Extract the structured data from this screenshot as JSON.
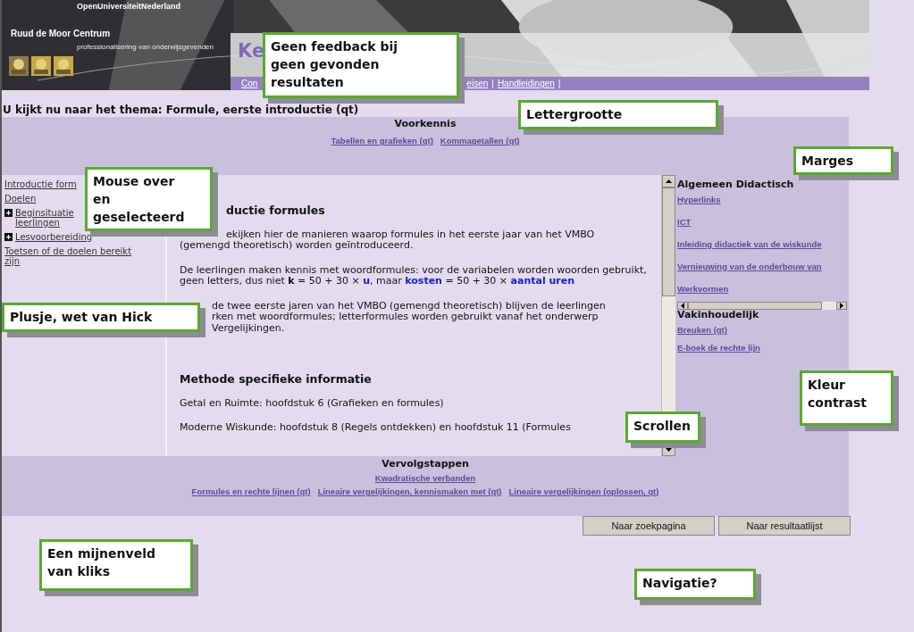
{
  "banner": {
    "institution": "OpenUniversiteitNederland",
    "centre": "Ruud de Moor Centrum",
    "tagline": "professionalisering van onderwijsgevenden",
    "title": "Ke",
    "nav_start": "Con",
    "nav": [
      {
        "kind": "link",
        "label": "eisen"
      },
      {
        "kind": "sep",
        "label": "|"
      },
      {
        "kind": "link",
        "label": "Handleidingen"
      },
      {
        "kind": "sep",
        "label": "|"
      }
    ]
  },
  "theme_line": "U kijkt nu naar het thema: Formule, eerste introductie (qt)",
  "prior_knowledge": {
    "title": "Voorkennis",
    "links": [
      "Tabellen en grafieken (qt)",
      "Kommagetallen (qt)"
    ]
  },
  "menu": [
    {
      "lines": [
        "Introductie form"
      ],
      "expandable": false
    },
    {
      "lines": [
        "Doelen"
      ],
      "expandable": false
    },
    {
      "lines": [
        "Beginsituatie",
        "leerlingen"
      ],
      "expandable": true
    },
    {
      "lines": [
        "Lesvoorbereiding"
      ],
      "expandable": true
    },
    {
      "lines": [
        "Toetsen of de doelen bereikt",
        "zijn"
      ],
      "expandable": false
    }
  ],
  "content": [
    {
      "kind": "heading",
      "lines": [
        "ductie formules"
      ]
    },
    {
      "kind": "text",
      "lines": [
        "ekijken hier de manieren waarop formules in het eerste jaar van het VMBO",
        "(gemengd theoretisch) worden geïntroduceerd."
      ]
    },
    {
      "kind": "rich",
      "segments": [
        {
          "kind": "plain",
          "text": "De leerlingen maken kennis met woordformules: voor de variabelen worden woorden gebruikt, geen letters, dus niet "
        },
        {
          "kind": "bold",
          "text": "k"
        },
        {
          "kind": "plain",
          "text": " = 50 + 30 × "
        },
        {
          "kind": "variable",
          "text": "u"
        },
        {
          "kind": "plain",
          "text": ", maar "
        },
        {
          "kind": "variable",
          "text": "kosten"
        },
        {
          "kind": "plain",
          "text": " = 50 + 30 × "
        },
        {
          "kind": "variable",
          "text": "aantal uren"
        }
      ]
    },
    {
      "kind": "text",
      "lines": [
        "de twee eerste jaren van het VMBO (gemengd theoretisch) blijven de leerlingen",
        "rken met woordformules; letterformules worden gebruikt vanaf het onderwerp",
        "Vergelijkingen."
      ]
    },
    {
      "kind": "heading",
      "lines": [
        "Methode specifieke informatie"
      ]
    },
    {
      "kind": "text",
      "lines": [
        "Getal en Ruimte: hoofdstuk 6 (Grafieken en formules)"
      ]
    },
    {
      "kind": "text",
      "lines": [
        "Moderne Wiskunde: hoofdstuk 8 (Regels ontdekken) en hoofdstuk 11 (Formules"
      ]
    }
  ],
  "side": [
    {
      "kind": "scrolling",
      "title": "Algemeen Didactisch",
      "links": [
        "Hyperlinks",
        "ICT",
        "Inleiding didactiek van de wiskunde",
        "Vernieuwing van de onderbouw van",
        "Werkvormen"
      ]
    },
    {
      "kind": "plain",
      "title": "Vakinhoudelijk",
      "links": [
        "Breuken (qt)",
        "E-boek de rechte lijn"
      ]
    }
  ],
  "next_steps": {
    "title": "Vervolgstappen",
    "main_link": "Kwadratische verbanden",
    "links": [
      "Formules en rechte lijnen (qt)",
      "Lineaire vergelijkingen, kennismaken met (qt)",
      "Lineaire vergelijkingen (oplossen, qt)"
    ]
  },
  "buttons": [
    "Naar zoekpagina",
    "Naar resultaatlijst"
  ],
  "callouts": [
    "Geen feedback bij geen gevonden resultaten",
    "Lettergrootte",
    "Marges",
    "Mouse over en geselecteerd",
    "Plusje, wet van Hick",
    "Kleur contrast",
    "Scrollen",
    "Een mijnenveld van kliks",
    "Navigatie?"
  ]
}
